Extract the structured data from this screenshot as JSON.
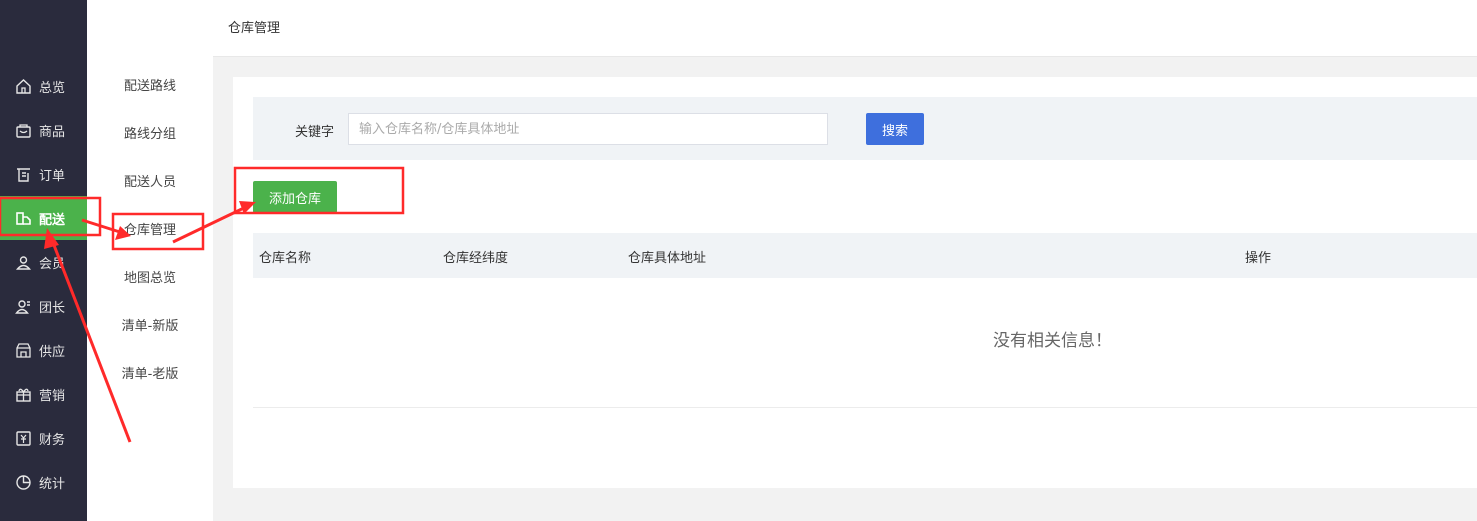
{
  "sidebar": {
    "items": [
      {
        "label": "总览",
        "icon": "home-icon"
      },
      {
        "label": "商品",
        "icon": "goods-icon"
      },
      {
        "label": "订单",
        "icon": "order-icon"
      },
      {
        "label": "配送",
        "icon": "delivery-icon",
        "active": true
      },
      {
        "label": "会员",
        "icon": "member-icon"
      },
      {
        "label": "团长",
        "icon": "leader-icon"
      },
      {
        "label": "供应",
        "icon": "supply-icon"
      },
      {
        "label": "营销",
        "icon": "gift-icon"
      },
      {
        "label": "财务",
        "icon": "finance-icon"
      },
      {
        "label": "统计",
        "icon": "chart-icon"
      }
    ]
  },
  "submenu": {
    "items": [
      {
        "label": "配送路线"
      },
      {
        "label": "路线分组"
      },
      {
        "label": "配送人员"
      },
      {
        "label": "仓库管理",
        "active": true
      },
      {
        "label": "地图总览"
      },
      {
        "label": "清单-新版"
      },
      {
        "label": "清单-老版"
      }
    ]
  },
  "header": {
    "title": "仓库管理"
  },
  "search": {
    "label": "关键字",
    "placeholder": "输入仓库名称/仓库具体地址",
    "value": "",
    "button": "搜索"
  },
  "add_button": "添加仓库",
  "table": {
    "columns": [
      "仓库名称",
      "仓库经纬度",
      "仓库具体地址",
      "操作"
    ],
    "rows": [],
    "empty_text": "没有相关信息！"
  },
  "colors": {
    "sidebar_bg": "#2a2b3d",
    "active_green": "#4bb24b",
    "search_blue": "#3e6fdd",
    "annotation_red": "#ff2a2a"
  }
}
